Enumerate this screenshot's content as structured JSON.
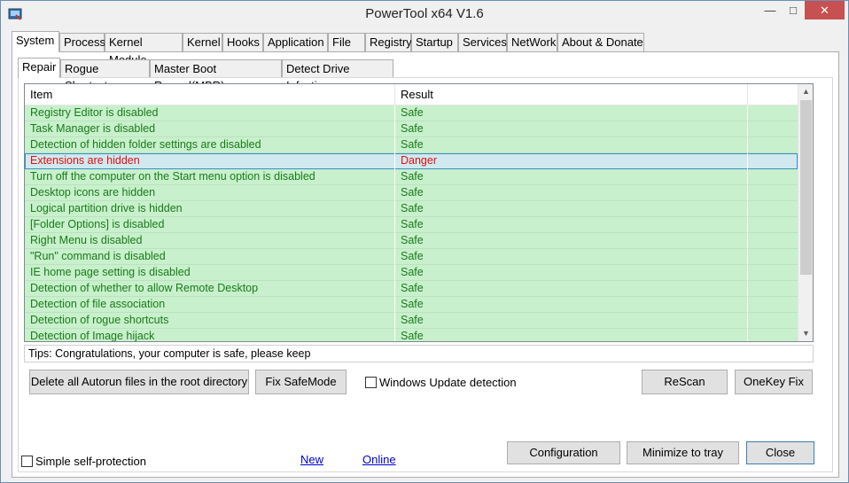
{
  "window": {
    "title": "PowerTool x64 V1.6"
  },
  "titlebar": {
    "minimize": "—",
    "maximize": "□",
    "close": "✕"
  },
  "main_tabs": [
    "System",
    "Process",
    "Kernel Module",
    "Kernel",
    "Hooks",
    "Application",
    "File",
    "Registry",
    "Startup",
    "Services",
    "NetWork",
    "About & Donate"
  ],
  "sub_tabs": [
    "Repair",
    "Rogue Shortcuts",
    "Master Boot Record(MBR)",
    "Detect Drive Infection"
  ],
  "table": {
    "headers": [
      "Item",
      "Result"
    ],
    "rows": [
      {
        "item": "Registry Editor is disabled",
        "result": "Safe"
      },
      {
        "item": "Task Manager is disabled",
        "result": "Safe"
      },
      {
        "item": "Detection of hidden folder settings are disabled",
        "result": "Safe"
      },
      {
        "item": "Extensions are hidden",
        "result": "Danger"
      },
      {
        "item": "Turn off the computer on the Start menu option is disabled",
        "result": "Safe"
      },
      {
        "item": "Desktop icons are hidden",
        "result": "Safe"
      },
      {
        "item": "Logical partition drive is hidden",
        "result": "Safe"
      },
      {
        "item": "[Folder Options] is disabled",
        "result": "Safe"
      },
      {
        "item": "Right Menu is disabled",
        "result": "Safe"
      },
      {
        "item": "\"Run\" command is disabled",
        "result": "Safe"
      },
      {
        "item": "IE home page setting is disabled",
        "result": "Safe"
      },
      {
        "item": "Detection of whether to allow Remote Desktop",
        "result": "Safe"
      },
      {
        "item": "Detection of file association",
        "result": "Safe"
      },
      {
        "item": "Detection of rogue shortcuts",
        "result": "Safe"
      },
      {
        "item": "Detection of Image hijack",
        "result": "Safe"
      }
    ]
  },
  "tips": "Tips: Congratulations, your computer is safe, please keep",
  "actions": {
    "delete_autorun": "Delete all Autorun files in the root directory",
    "fix_safemode": "Fix SafeMode",
    "windows_update": "Windows Update detection",
    "rescan": "ReScan",
    "onekey_fix": "OneKey Fix"
  },
  "footer": {
    "self_protection": "Simple self-protection",
    "new_version": "New Version",
    "online_update": "Online Update",
    "configuration": "Configuration",
    "minimize_tray": "Minimize to tray",
    "close": "Close"
  },
  "colors": {
    "safe_row_bg": "#c8f0cc",
    "safe_text": "#1a7a1a",
    "danger_text": "#e01010",
    "selection": "#3c8dc8"
  }
}
